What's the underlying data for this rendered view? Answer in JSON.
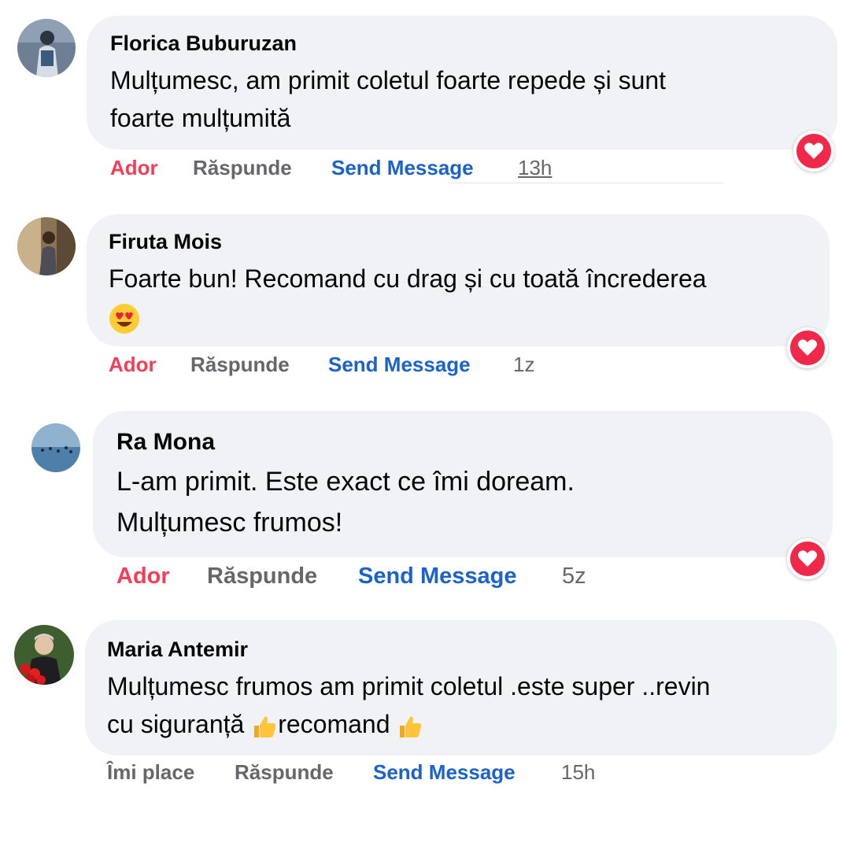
{
  "comments": [
    {
      "name": "Florica Buburuzan",
      "lines": [
        "Mulțumesc, am primit coletul foarte repede și sunt",
        "foarte mulțumită"
      ],
      "actions": {
        "react": "Ador",
        "reply": "Răspunde",
        "send": "Send Message",
        "time": "13h"
      },
      "reaction_icon": "heart-icon"
    },
    {
      "name": "Firuta Mois",
      "lines": [
        "Foarte bun! Recomand cu drag și cu toată încrederea"
      ],
      "emoji": "smiling-face-with-heart-eyes",
      "actions": {
        "react": "Ador",
        "reply": "Răspunde",
        "send": "Send Message",
        "time": "1z"
      },
      "reaction_icon": "heart-icon"
    },
    {
      "name": "Ra Mona",
      "lines": [
        "L-am primit. Este exact ce îmi doream.",
        "Mulțumesc frumos!"
      ],
      "actions": {
        "react": "Ador",
        "reply": "Răspunde",
        "send": "Send Message",
        "time": "5z"
      },
      "reaction_icon": "heart-icon"
    },
    {
      "name": "Maria Antemir",
      "lines": [
        "Mulțumesc frumos am primit coletul .este super ..revin",
        "cu siguranță",
        "recomand"
      ],
      "emoji": "thumbs-up",
      "actions": {
        "react": "Îmi place",
        "reply": "Răspunde",
        "send": "Send Message",
        "time": "15h"
      }
    }
  ],
  "colors": {
    "love": "#f33e58",
    "link": "#1b62c9",
    "muted": "#65676b",
    "bubble": "#f0f2f5"
  }
}
